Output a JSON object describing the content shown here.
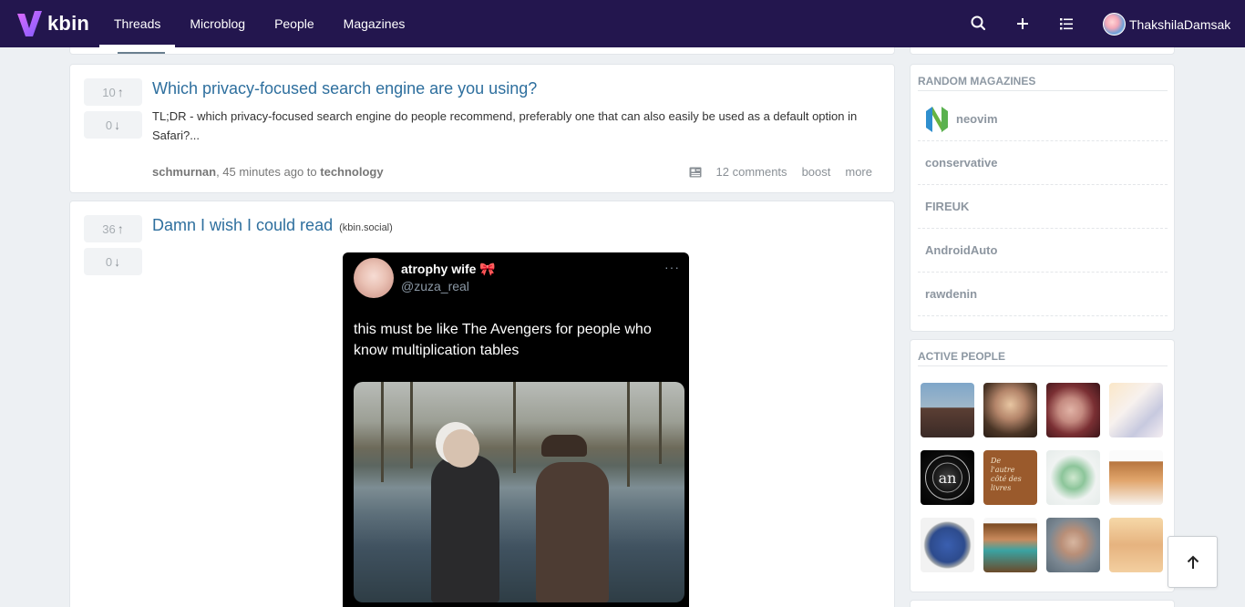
{
  "app": {
    "name": "kbin",
    "nav": [
      "Threads",
      "Microblog",
      "People",
      "Magazines"
    ],
    "active_nav": "Threads",
    "user": "ThakshilaDamsak"
  },
  "posts": [
    {
      "upvotes": "10",
      "downvotes": "0",
      "title": "Which privacy-focused search engine are you using?",
      "body": "TL;DR - which privacy-focused search engine do people recommend, preferably one that can also easily be used as a default option in Safari?...",
      "author": "schmurnan",
      "time": ", 45 minutes ago to ",
      "magazine": "technology",
      "comments": "12 comments",
      "boost": "boost",
      "more": "more"
    },
    {
      "upvotes": "36",
      "downvotes": "0",
      "title": "Damn I wish I could read",
      "domain": "(kbin.social)",
      "tweet": {
        "name": "atrophy wife 🎀",
        "handle": "@zuza_real",
        "dots": "···",
        "text": "this must be like The Avengers for people who know multiplication tables"
      }
    }
  ],
  "sidebar": {
    "random_magazines": {
      "title": "RANDOM MAGAZINES",
      "items": [
        "neovim",
        "conservative",
        "FIREUK",
        "AndroidAuto",
        "rawdenin"
      ]
    },
    "active_people": {
      "title": "ACTIVE PEOPLE",
      "count": 12
    }
  },
  "colors": {
    "header_bg": "#23164e",
    "link": "#2e6f9e",
    "logo_gradient_start": "#c13cff",
    "logo_gradient_end": "#7a5cff"
  }
}
